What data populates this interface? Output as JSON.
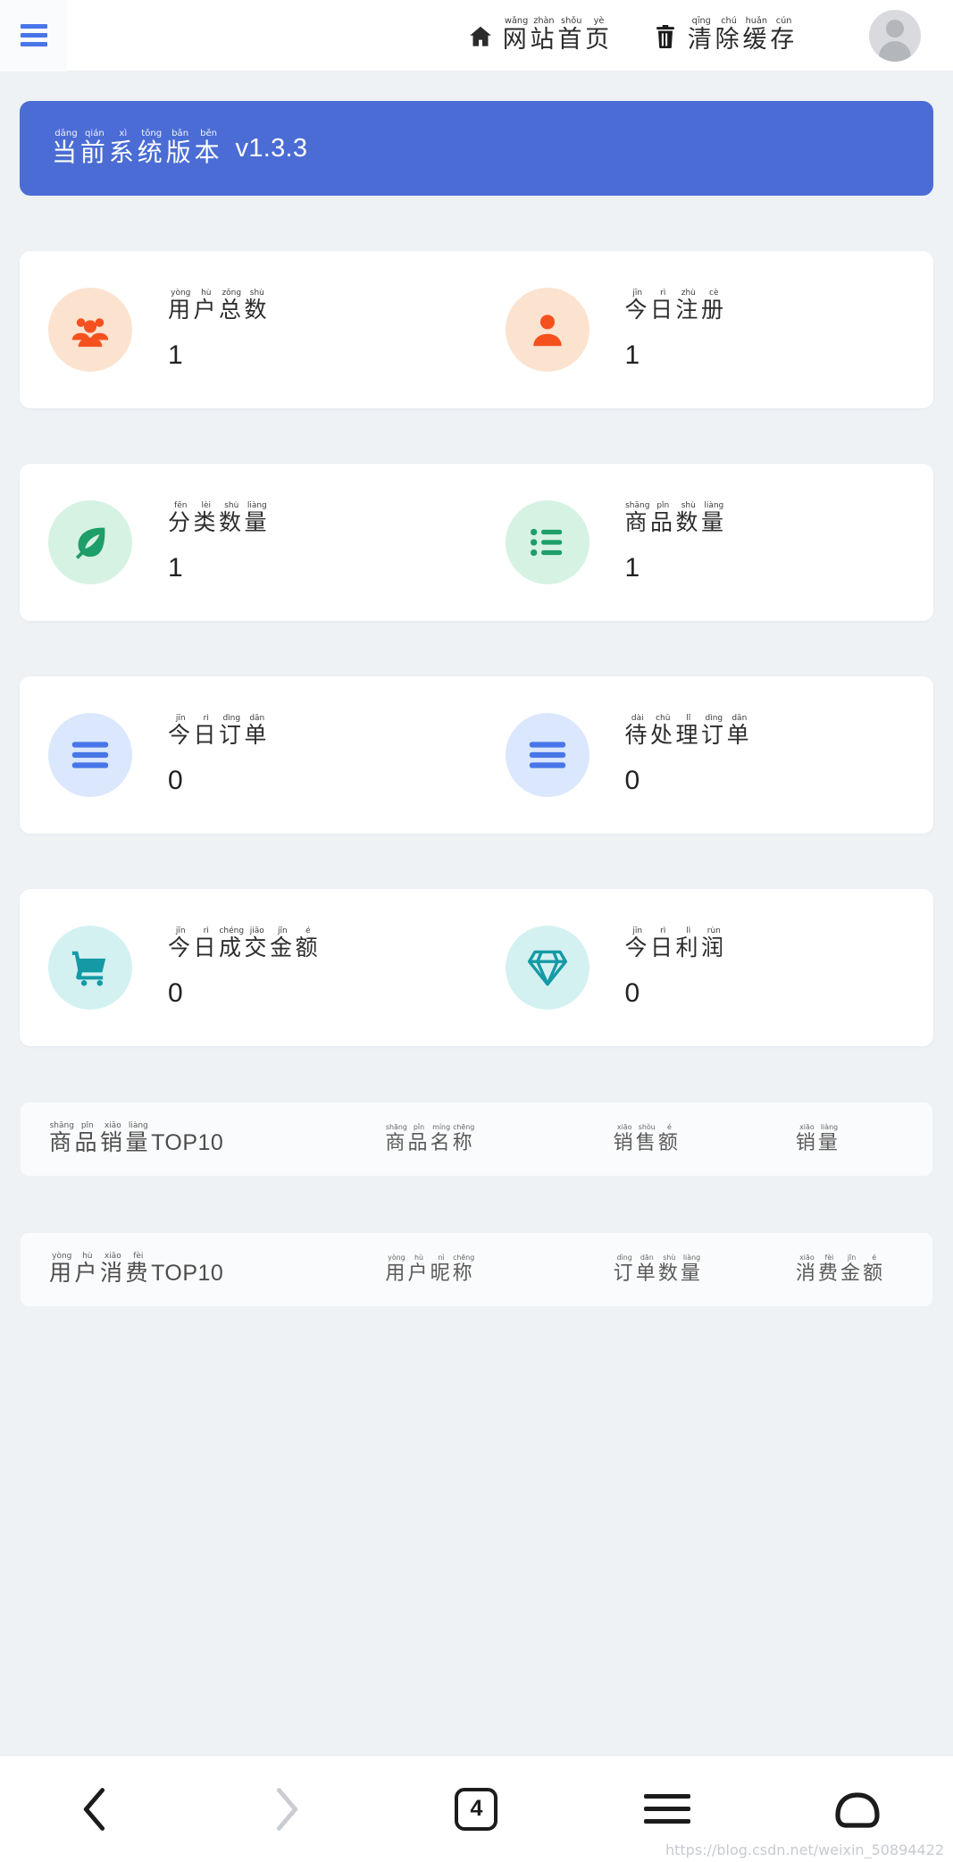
{
  "header": {
    "menu_icon": "hamburger-icon",
    "actions": [
      {
        "icon": "home-icon",
        "label": "网站首页",
        "pinyin": [
          "wǎng",
          "zhàn",
          "shǒu",
          "yè"
        ]
      },
      {
        "icon": "trash-icon",
        "label": "清除缓存",
        "pinyin": [
          "qīng",
          "chú",
          "huǎn",
          "cún"
        ]
      }
    ],
    "avatar": "user-avatar"
  },
  "version_banner": {
    "label": "当前系统版本",
    "pinyin": [
      "dāng",
      "qián",
      "xì",
      "tǒng",
      "bǎn",
      "běn"
    ],
    "version": "v1.3.3",
    "color": "#4a6cd4"
  },
  "stat_cards": [
    {
      "theme_circle": "#FCE3D0",
      "theme_icon": "#F4511E",
      "items": [
        {
          "icon": "users-group-icon",
          "label": "用户总数",
          "pinyin": [
            "yòng",
            "hù",
            "zǒng",
            "shù"
          ],
          "value": "1"
        },
        {
          "icon": "user-single-icon",
          "label": "今日注册",
          "pinyin": [
            "jīn",
            "rì",
            "zhù",
            "cè"
          ],
          "value": "1"
        }
      ]
    },
    {
      "theme_circle": "#D6F2E3",
      "theme_icon": "#1E9E68",
      "items": [
        {
          "icon": "leaf-icon",
          "label": "分类数量",
          "pinyin": [
            "fēn",
            "lèi",
            "shù",
            "liàng"
          ],
          "value": "1"
        },
        {
          "icon": "list-dots-icon",
          "label": "商品数量",
          "pinyin": [
            "shāng",
            "pǐn",
            "shù",
            "liàng"
          ],
          "value": "1"
        }
      ]
    },
    {
      "theme_circle": "#DAE7FD",
      "theme_icon": "#4876E8",
      "items": [
        {
          "icon": "list-lines-icon",
          "label": "今日订单",
          "pinyin": [
            "jīn",
            "rì",
            "dìng",
            "dān"
          ],
          "value": "0"
        },
        {
          "icon": "list-lines-icon",
          "label": "待处理订单",
          "pinyin": [
            "dài",
            "chǔ",
            "lǐ",
            "dìng",
            "dān"
          ],
          "value": "0"
        }
      ]
    },
    {
      "theme_circle": "#D4F1F2",
      "theme_icon": "#159AA5",
      "items": [
        {
          "icon": "shopping-cart-icon",
          "label": "今日成交金额",
          "pinyin": [
            "jīn",
            "rì",
            "chéng",
            "jiāo",
            "jīn",
            "é"
          ],
          "value": "0"
        },
        {
          "icon": "diamond-icon",
          "label": "今日利润",
          "pinyin": [
            "jīn",
            "rì",
            "lì",
            "rùn"
          ],
          "value": "0"
        }
      ]
    }
  ],
  "top_tables": [
    {
      "title_cn": "商品销量",
      "title_pinyin": [
        "shāng",
        "pǐn",
        "xiāo",
        "liàng"
      ],
      "title_suffix": "TOP10",
      "columns": [
        {
          "label": "商品名称",
          "pinyin": [
            "shāng",
            "pǐn",
            "míng",
            "chēng"
          ]
        },
        {
          "label": "销售额",
          "pinyin": [
            "xiāo",
            "shòu",
            "é"
          ]
        },
        {
          "label": "销量",
          "pinyin": [
            "xiāo",
            "liàng"
          ]
        }
      ]
    },
    {
      "title_cn": "用户消费",
      "title_pinyin": [
        "yòng",
        "hù",
        "xiāo",
        "fèi"
      ],
      "title_suffix": "TOP10",
      "columns": [
        {
          "label": "用户昵称",
          "pinyin": [
            "yòng",
            "hù",
            "nì",
            "chēng"
          ]
        },
        {
          "label": "订单数量",
          "pinyin": [
            "dìng",
            "dān",
            "shù",
            "liàng"
          ]
        },
        {
          "label": "消费金额",
          "pinyin": [
            "xiāo",
            "fèi",
            "jīn",
            "é"
          ]
        }
      ]
    }
  ],
  "bottom_nav": {
    "back": "back-chevron-icon",
    "forward": "forward-chevron-icon",
    "tab_count": "4",
    "menu": "menu-icon",
    "home": "home-outline-icon"
  },
  "watermark": "https://blog.csdn.net/weixin_50894422"
}
